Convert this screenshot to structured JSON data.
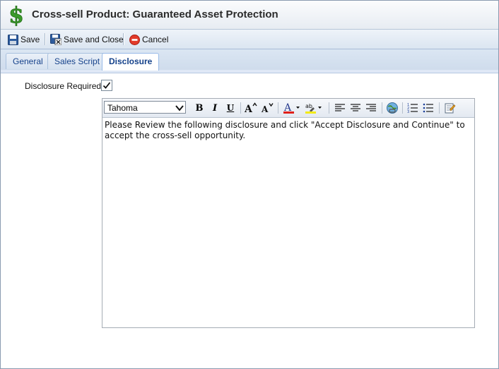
{
  "window": {
    "title": "Cross-sell Product: Guaranteed Asset Protection",
    "title_icon": "dollar-sign-icon"
  },
  "toolbar": {
    "save_label": "Save",
    "save_close_label": "Save and Close",
    "cancel_label": "Cancel"
  },
  "tabs": [
    {
      "label": "General",
      "active": false
    },
    {
      "label": "Sales Script",
      "active": false
    },
    {
      "label": "Disclosure",
      "active": true
    }
  ],
  "form": {
    "disclosure_required_label": "Disclosure Required:",
    "disclosure_required_checked": true
  },
  "editor": {
    "font_value": "Tahoma",
    "content": "Please Review the following disclosure and click \"Accept Disclosure and Continue\" to accept the cross-sell opportunity.",
    "buttons": [
      "bold-icon",
      "italic-icon",
      "underline-icon",
      "font-size-increase-icon",
      "font-size-decrease-icon",
      "font-color-icon",
      "highlight-color-icon",
      "align-left-icon",
      "align-center-icon",
      "align-right-icon",
      "insert-link-icon",
      "ordered-list-icon",
      "unordered-list-icon",
      "source-edit-icon"
    ]
  },
  "colors": {
    "accent": "#15428b",
    "font_color_bar": "#e0201b",
    "highlight_bar": "#f2ea17",
    "dollar_green": "#3a9a2a"
  }
}
